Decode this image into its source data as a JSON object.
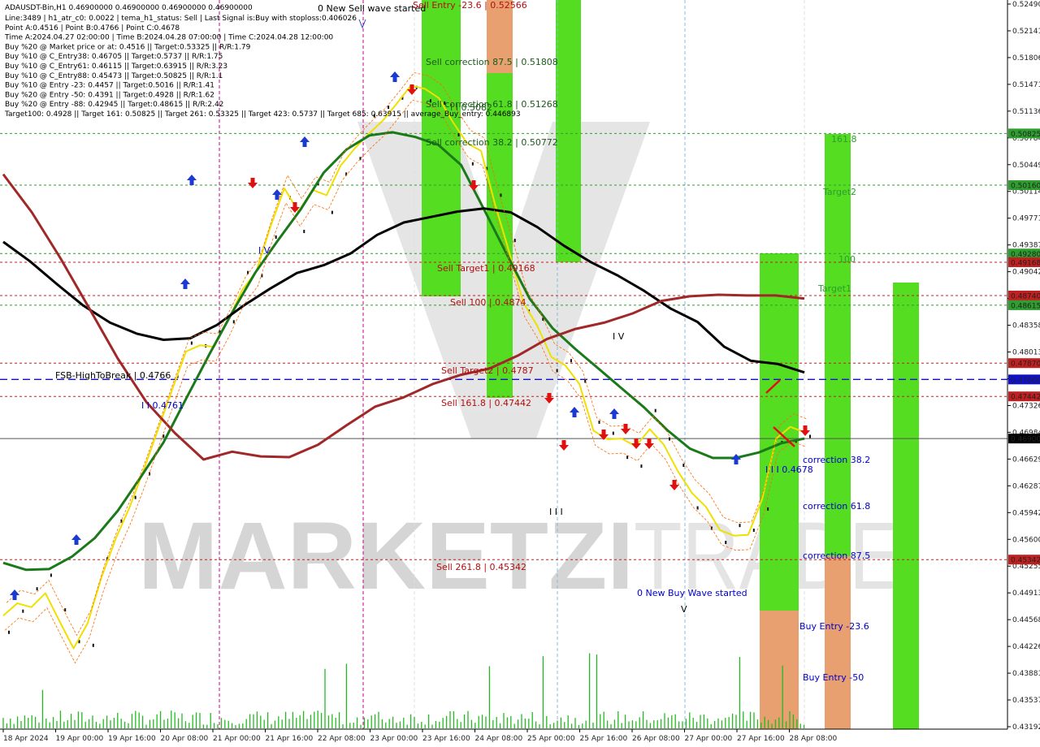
{
  "symbol_header": "ADAUSDT-Bin,H1  0.46900000 0.46900000 0.46900000 0.46900000",
  "info_lines": [
    "Line:3489  |  h1_atr_c0: 0.0022  |  tema_h1_status: Sell  |  Last Signal is:Buy with stoploss:0.406026",
    "Point A:0.4516  |  Point B:0.4766  |  Point C:0.4678",
    "Time A:2024.04.27 02:00:00  |  Time B:2024.04.28 07:00:00  |  Time C:2024.04.28 12:00:00",
    "Buy %20 @ Market price or at: 0.4516  ||  Target:0.53325  ||  R/R:1.79",
    "Buy %10 @ C_Entry38: 0.46705  ||  Target:0.5737  ||  R/R:1.75",
    "Buy %10 @ C_Entry61: 0.46115  ||  Target:0.63915  ||  R/R:3.23",
    "Buy %10 @ C_Entry88: 0.45473  ||  Target:0.50825  ||  R/R:1.1",
    "Buy %10 @ Entry -23: 0.4457  ||  Target:0.5016  ||  R/R:1.41",
    "Buy %20 @ Entry -50: 0.4391  ||  Target:0.4928  ||  R/R:1.62",
    "Buy %20 @ Entry -88: 0.42945  ||  Target:0.48615  ||  R/R:2.42",
    "Target100: 0.4928  ||  Target 161: 0.50825  ||  Target 261: 0.53325  ||  Target 423: 0.5737  ||  Target 685: 0.63915  ||  average_Buy_entry: 0.446893"
  ],
  "watermark": "MARKETZITRADE",
  "colors": {
    "green_zone": "#55dd22",
    "orange_zone": "#e8a070",
    "sell_text": "#b01010",
    "buy_text": "#0000cc",
    "level_green": "#2e9e2e",
    "level_red": "#c02020",
    "level_blue": "#1010cc",
    "yellow_line": "#f0e000",
    "dark_green_ma": "#1a7a1a",
    "black_ma": "#000000",
    "brown_ma": "#a02828"
  },
  "chart_data": {
    "type": "line",
    "title": "ADAUSDT-Bin,H1",
    "ylim": [
      0.43192,
      0.5249
    ],
    "y_ticks": [
      "0.52490",
      "0.52141",
      "0.51806",
      "0.51471",
      "0.51136",
      "0.50784",
      "0.50449",
      "0.50114",
      "0.49771",
      "0.49387",
      "0.49042",
      "0.48700",
      "0.48358",
      "0.48013",
      "0.47671",
      "0.47326",
      "0.46984",
      "0.46629",
      "0.46287",
      "0.45942",
      "0.45600",
      "0.45255",
      "0.44913",
      "0.44568",
      "0.44226",
      "0.43881",
      "0.43537",
      "0.43192"
    ],
    "x_ticks": [
      "18 Apr 2024",
      "19 Apr 00:00",
      "19 Apr 16:00",
      "20 Apr 08:00",
      "21 Apr 00:00",
      "21 Apr 16:00",
      "22 Apr 08:00",
      "23 Apr 00:00",
      "23 Apr 16:00",
      "24 Apr 08:00",
      "25 Apr 00:00",
      "25 Apr 16:00",
      "26 Apr 08:00",
      "27 Apr 00:00",
      "27 Apr 16:00",
      "28 Apr 08:00"
    ],
    "levels": [
      {
        "value": 0.50825,
        "label": "0.50825",
        "kind": "green"
      },
      {
        "value": 0.5016,
        "label": "0.50160",
        "kind": "green"
      },
      {
        "value": 0.4928,
        "label": "0.49280",
        "kind": "green"
      },
      {
        "value": 0.49168,
        "label": "0.49168",
        "kind": "red"
      },
      {
        "value": 0.4874,
        "label": "0.48740",
        "kind": "red"
      },
      {
        "value": 0.48615,
        "label": "0.48615",
        "kind": "green"
      },
      {
        "value": 0.4787,
        "label": "0.47870",
        "kind": "red"
      },
      {
        "value": 0.4766,
        "label": "0.47660",
        "kind": "blue"
      },
      {
        "value": 0.47442,
        "label": "0.47442",
        "kind": "red"
      },
      {
        "value": 0.469,
        "label": "0.46900",
        "kind": "current"
      },
      {
        "value": 0.45342,
        "label": "0.45342",
        "kind": "red"
      }
    ],
    "annotations": [
      {
        "text": "0 New Sell wave started",
        "color": "#000000"
      },
      {
        "text": "Sell Entry -23.6 | 0.52566",
        "color": "#b01010"
      },
      {
        "text": "Sell correction 87.5 | 0.51808",
        "color": "#1a5a1a"
      },
      {
        "text": "Sell correction 61.8 | 0.51268",
        "color": "#1a5a1a"
      },
      {
        "text": "I I 0.5082",
        "color": "#1a5a1a"
      },
      {
        "text": "Sell correction 38.2 | 0.50772",
        "color": "#1a5a1a"
      },
      {
        "text": "Sell Target1 | 0.49168",
        "color": "#b01010"
      },
      {
        "text": "Sell 100 | 0.4874",
        "color": "#b01010"
      },
      {
        "text": "Sell Target2 | 0.4787",
        "color": "#b01010"
      },
      {
        "text": "Sell 161.8 | 0.47442",
        "color": "#b01010"
      },
      {
        "text": "Sell 261.8 | 0.45342",
        "color": "#b01010"
      },
      {
        "text": "FSB-HighToBreak | 0.4766",
        "color": "#000000"
      },
      {
        "text": "I I 0.4761",
        "color": "#0000cc"
      },
      {
        "text": "I V",
        "color": "#0000cc"
      },
      {
        "text": "I V",
        "color": "#000000"
      },
      {
        "text": "I I I",
        "color": "#000000"
      },
      {
        "text": "0 New Buy Wave started",
        "color": "#0000cc"
      },
      {
        "text": "V",
        "color": "#000000"
      },
      {
        "text": "I I I 0.4678",
        "color": "#0000cc"
      },
      {
        "text": "correction 38.2",
        "color": "#0000cc"
      },
      {
        "text": "correction 61.8",
        "color": "#0000cc"
      },
      {
        "text": "correction 87.5",
        "color": "#0000cc"
      },
      {
        "text": "Buy Entry -23.6",
        "color": "#0000cc"
      },
      {
        "text": "Buy Entry -50",
        "color": "#0000cc"
      },
      {
        "text": "161.8",
        "color": "#2e9e2e"
      },
      {
        "text": "Target2",
        "color": "#2e9e2e"
      },
      {
        "text": "100",
        "color": "#2e9e2e"
      },
      {
        "text": "Target1",
        "color": "#2e9e2e"
      }
    ],
    "series": [
      {
        "kind": "price-yellow",
        "values": [
          0.4462,
          0.4478,
          0.4473,
          0.4491,
          0.4455,
          0.442,
          0.4452,
          0.4512,
          0.4561,
          0.4602,
          0.465,
          0.4701,
          0.4752,
          0.4802,
          0.481,
          0.4808,
          0.4842,
          0.4881,
          0.4905,
          0.4962,
          0.5012,
          0.4982,
          0.501,
          0.5003,
          0.5041,
          0.5063,
          0.5082,
          0.5099,
          0.5121,
          0.5144,
          0.514,
          0.5128,
          0.5097,
          0.507,
          0.506,
          0.4991,
          0.493,
          0.4865,
          0.4835,
          0.4795,
          0.4784,
          0.476,
          0.47,
          0.4689,
          0.469,
          0.468,
          0.4702,
          0.4682,
          0.4648,
          0.462,
          0.4602,
          0.4572,
          0.4565,
          0.4566,
          0.4612,
          0.469,
          0.4705,
          0.4698
        ]
      },
      {
        "kind": "ma-darkgreen",
        "values": [
          0.453,
          0.4521,
          0.4522,
          0.4538,
          0.4562,
          0.4597,
          0.464,
          0.4685,
          0.4742,
          0.4798,
          0.4852,
          0.4903,
          0.4945,
          0.4985,
          0.5032,
          0.5062,
          0.508,
          0.5084,
          0.5078,
          0.5068,
          0.5042,
          0.4985,
          0.4927,
          0.487,
          0.4832,
          0.4805,
          0.478,
          0.4755,
          0.473,
          0.4701,
          0.4677,
          0.4665,
          0.4665,
          0.4672,
          0.4684,
          0.469
        ]
      },
      {
        "kind": "ma-black",
        "values": [
          0.4943,
          0.4918,
          0.4889,
          0.4861,
          0.4839,
          0.4825,
          0.4817,
          0.4819,
          0.4836,
          0.4861,
          0.4883,
          0.4903,
          0.4913,
          0.4928,
          0.4952,
          0.4968,
          0.4975,
          0.4982,
          0.4986,
          0.4981,
          0.4962,
          0.4938,
          0.4917,
          0.49,
          0.488,
          0.4857,
          0.484,
          0.4808,
          0.479,
          0.4786,
          0.4775
        ]
      },
      {
        "kind": "ma-brown",
        "values": [
          0.503,
          0.4981,
          0.4922,
          0.4858,
          0.4793,
          0.4737,
          0.4697,
          0.4663,
          0.4673,
          0.4667,
          0.4666,
          0.4682,
          0.4707,
          0.4731,
          0.4743,
          0.476,
          0.4772,
          0.478,
          0.4797,
          0.4818,
          0.4831,
          0.4839,
          0.4851,
          0.4867,
          0.4873,
          0.4875,
          0.4874,
          0.4874,
          0.487
        ]
      }
    ]
  }
}
